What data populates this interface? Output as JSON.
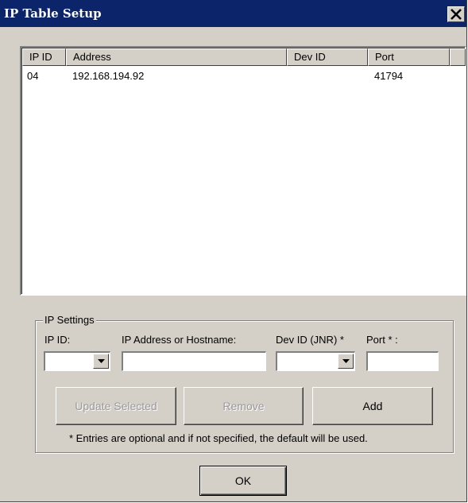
{
  "window": {
    "title": "IP Table Setup",
    "close_icon": "close-icon"
  },
  "table": {
    "columns": [
      "IP ID",
      "Address",
      "Dev ID",
      "Port"
    ],
    "rows": [
      {
        "ip_id": "04",
        "address": "192.168.194.92",
        "dev_id": "",
        "port": "41794"
      }
    ]
  },
  "ip_settings": {
    "group_label": "IP Settings",
    "ip_id_label": "IP ID:",
    "address_label": "IP Address or Hostname:",
    "dev_id_label": "Dev ID (JNR) *",
    "port_label": "Port * :",
    "ip_id_value": "",
    "address_value": "",
    "dev_id_value": "",
    "port_value": "",
    "dropdown_icon": "chevron-down-icon"
  },
  "buttons": {
    "update_selected": "Update Selected",
    "remove": "Remove",
    "add": "Add",
    "ok": "OK"
  },
  "note": "* Entries are optional and if not specified, the default will be used.",
  "colors": {
    "title_bar": "#0b246a",
    "window_bg": "#d4d0c8"
  }
}
